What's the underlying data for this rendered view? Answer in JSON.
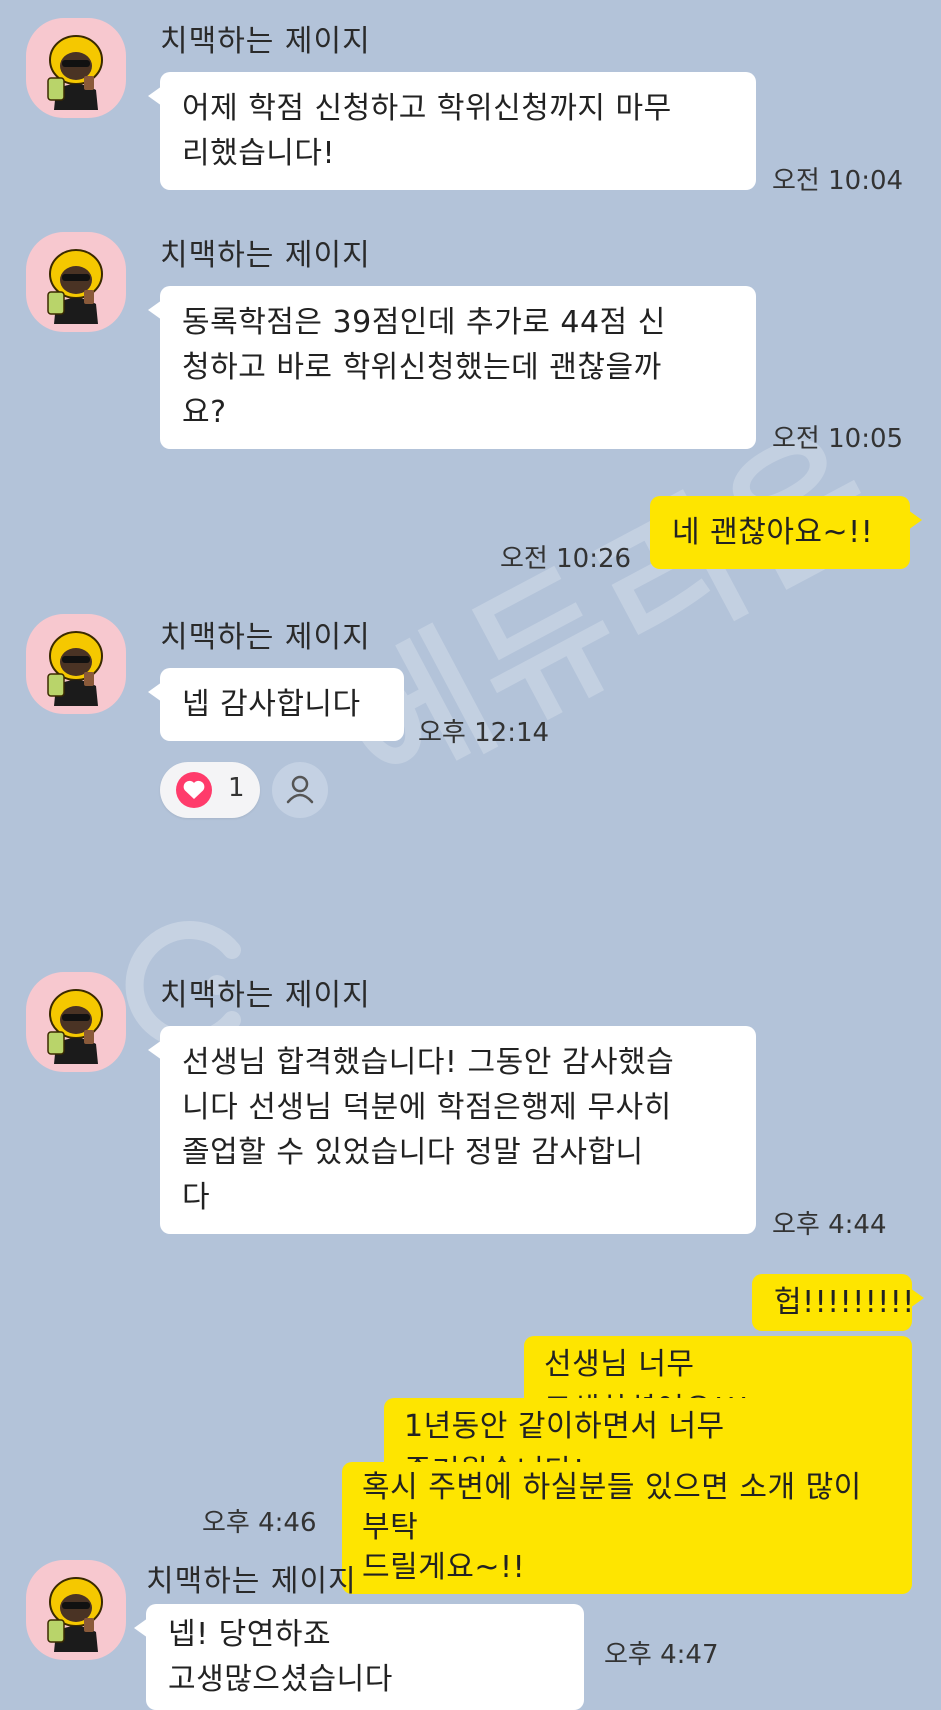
{
  "sender_name": "치맥하는 제이지",
  "watermark": "에듀리온",
  "messages": [
    {
      "text": "어제 학점 신청하고 학위신청까지 마무\n리했습니다!",
      "time": "오전 10:04"
    },
    {
      "text": "동록학점은 39점인데 추가로 44점 신\n청하고 바로 학위신청했는데 괜찮을까\n요?",
      "time": "오전 10:05"
    },
    {
      "text": "네 괜찮아요~!!",
      "time": "오전 10:26"
    },
    {
      "text": "넵 감사합니다",
      "time": "오후 12:14"
    },
    {
      "text": "선생님 합격했습니다! 그동안 감사했습\n니다 선생님 덕분에 학점은행제 무사히\n 졸업할 수 있었습니다 정말 감사합니\n다",
      "time": "오후 4:44"
    },
    {
      "text": "헙!!!!!!!!!"
    },
    {
      "text": "선생님 너무 고생하셨어요!!!"
    },
    {
      "text": "1년동안 같이하면서 너무 즐거웠습니다!"
    },
    {
      "text": "혹시 주변에 하실분들 있으면 소개 많이 부탁\n드릴게요~!!",
      "time": "오후 4:46"
    },
    {
      "text": "넵! 당연하죠 고생많으셨습니다",
      "time": "오후 4:47"
    }
  ],
  "reaction": {
    "icon": "heart-icon",
    "count": "1",
    "color": "#ff3b6b"
  },
  "colors": {
    "background": "#b3c3d9",
    "incoming_bubble": "#ffffff",
    "outgoing_bubble": "#fee500",
    "avatar_bg": "#f7c8cf"
  }
}
